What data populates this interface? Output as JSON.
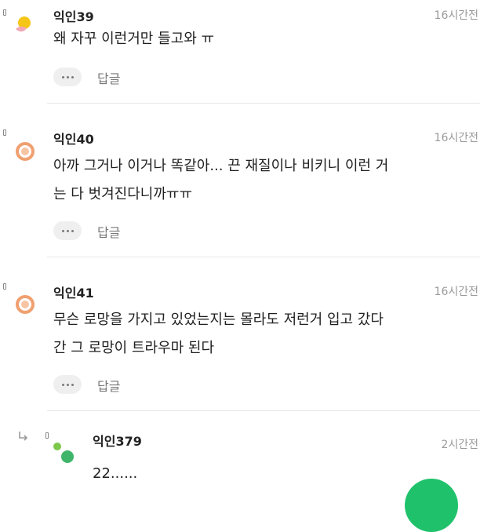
{
  "comments": [
    {
      "author": "익인39",
      "time": "16시간전",
      "lines": [
        "왜 자꾸 이런거만 들고와 ㅠ"
      ],
      "reply_label": "답글",
      "avatar": "sun-flower-icon"
    },
    {
      "author": "익인40",
      "time": "16시간전",
      "lines": [
        "아까 그거나 이거나 똑같아... 끈 재질이나 비키니 이런 거",
        "는 다 벗겨진다니까ㅠㅠ"
      ],
      "reply_label": "답글",
      "avatar": "orange-ring-icon"
    },
    {
      "author": "익인41",
      "time": "16시간전",
      "lines": [
        "무슨 로망을 가지고 있었는지는 몰라도 저런거 입고 갔다",
        "간 그 로망이 트라우마 된다"
      ],
      "reply_label": "답글",
      "avatar": "orange-ring-icon"
    }
  ],
  "reply": {
    "author": "익인379",
    "time": "2시간전",
    "text": "22......",
    "avatar": "green-dots-icon"
  },
  "colors": {
    "accent_green": "#1fc26b",
    "avatar_orange": "#f0a070",
    "avatar_yellow": "#f5c518",
    "avatar_pink": "#f3a6b5"
  }
}
